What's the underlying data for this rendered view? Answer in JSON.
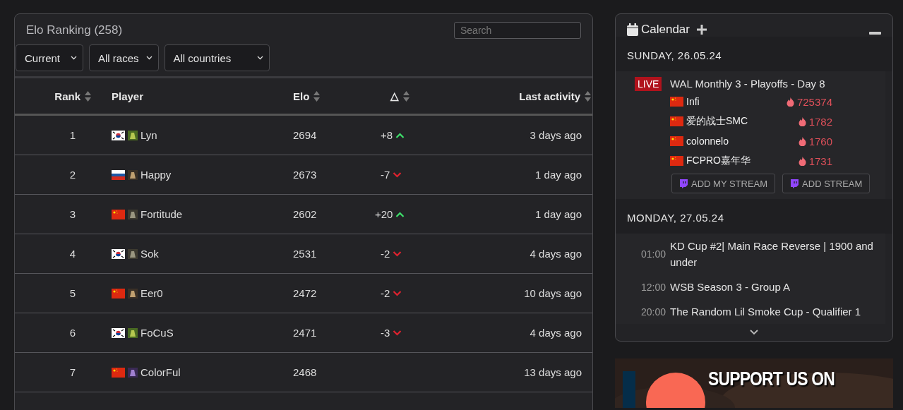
{
  "ranking": {
    "title": "Elo Ranking (258)",
    "search": {
      "placeholder": "Search"
    },
    "filters": [
      {
        "value": "Current"
      },
      {
        "value": "All races"
      },
      {
        "value": "All countries"
      }
    ],
    "columns": [
      {
        "label": "Rank",
        "sortable": true
      },
      {
        "label": "Player",
        "sortable": false
      },
      {
        "label": "Elo",
        "sortable": true
      },
      {
        "label": "△",
        "sortable": true
      },
      {
        "label": "Last activity",
        "sortable": true
      }
    ],
    "rows": [
      {
        "rank": "1",
        "player": "Lyn",
        "elo": "2694",
        "delta": "+8",
        "up": true,
        "last_activity": "3 days ago"
      },
      {
        "rank": "2",
        "player": "Happy",
        "elo": "2673",
        "delta": "-7",
        "up": false,
        "last_activity": "1 day ago"
      },
      {
        "rank": "3",
        "player": "Fortitude",
        "elo": "2602",
        "delta": "+20",
        "up": true,
        "last_activity": "1 day ago"
      },
      {
        "rank": "4",
        "player": "Sok",
        "elo": "2531",
        "delta": "-2",
        "up": false,
        "last_activity": "4 days ago"
      },
      {
        "rank": "5",
        "player": "Eer0",
        "elo": "2472",
        "delta": "-2",
        "up": false,
        "last_activity": "10 days ago"
      },
      {
        "rank": "6",
        "player": "FoCuS",
        "elo": "2471",
        "delta": "-3",
        "up": false,
        "last_activity": "4 days ago"
      },
      {
        "rank": "7",
        "player": "ColorFul",
        "elo": "2468",
        "last_activity": "13 days ago"
      }
    ]
  },
  "calendar": {
    "title": "Calendar",
    "days": [
      {
        "date": "SUNDAY, 26.05.24",
        "events": [
          {
            "badge": "LIVE",
            "title": "WAL Monthly 3 - Playoffs - Day 8",
            "streams": [
              {
                "name": "Infi",
                "viewers": "725374"
              },
              {
                "name": "爱的战士SMC",
                "viewers": "1782"
              },
              {
                "name": "colonnelo",
                "viewers": "1760"
              },
              {
                "name": "FCPRO嘉年华",
                "viewers": "1731"
              }
            ],
            "buttons": [
              "ADD MY STREAM",
              "ADD STREAM"
            ]
          }
        ]
      },
      {
        "date": "MONDAY, 27.05.24",
        "events": [
          {
            "time": "01:00",
            "title": "KD Cup #2| Main Race Reverse | 1900 and under"
          },
          {
            "time": "12:00",
            "title": "WSB Season 3 - Group A"
          },
          {
            "time": "20:00",
            "title": "The Random Lil Smoke Cup - Qualifier 1"
          }
        ]
      }
    ]
  },
  "banner": {
    "text": "SUPPORT US ON"
  }
}
